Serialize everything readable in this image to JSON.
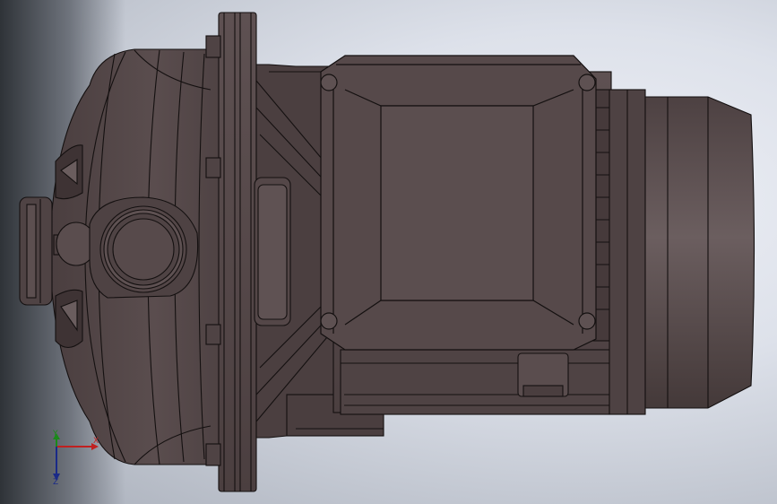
{
  "viewport": {
    "background_top": "#eef0f6",
    "background_edge": "#a9afba"
  },
  "model": {
    "name": "centrifugal-pump-with-motor",
    "view": "top",
    "body_color": "#56494a",
    "edge_color": "#141010",
    "highlight_color": "#6a5d5e"
  },
  "triad": {
    "x_label": "X",
    "y_label": "Y",
    "z_label": "Z",
    "x_color": "#c02020",
    "y_color": "#1a8a1a",
    "z_color": "#1a2a88"
  }
}
